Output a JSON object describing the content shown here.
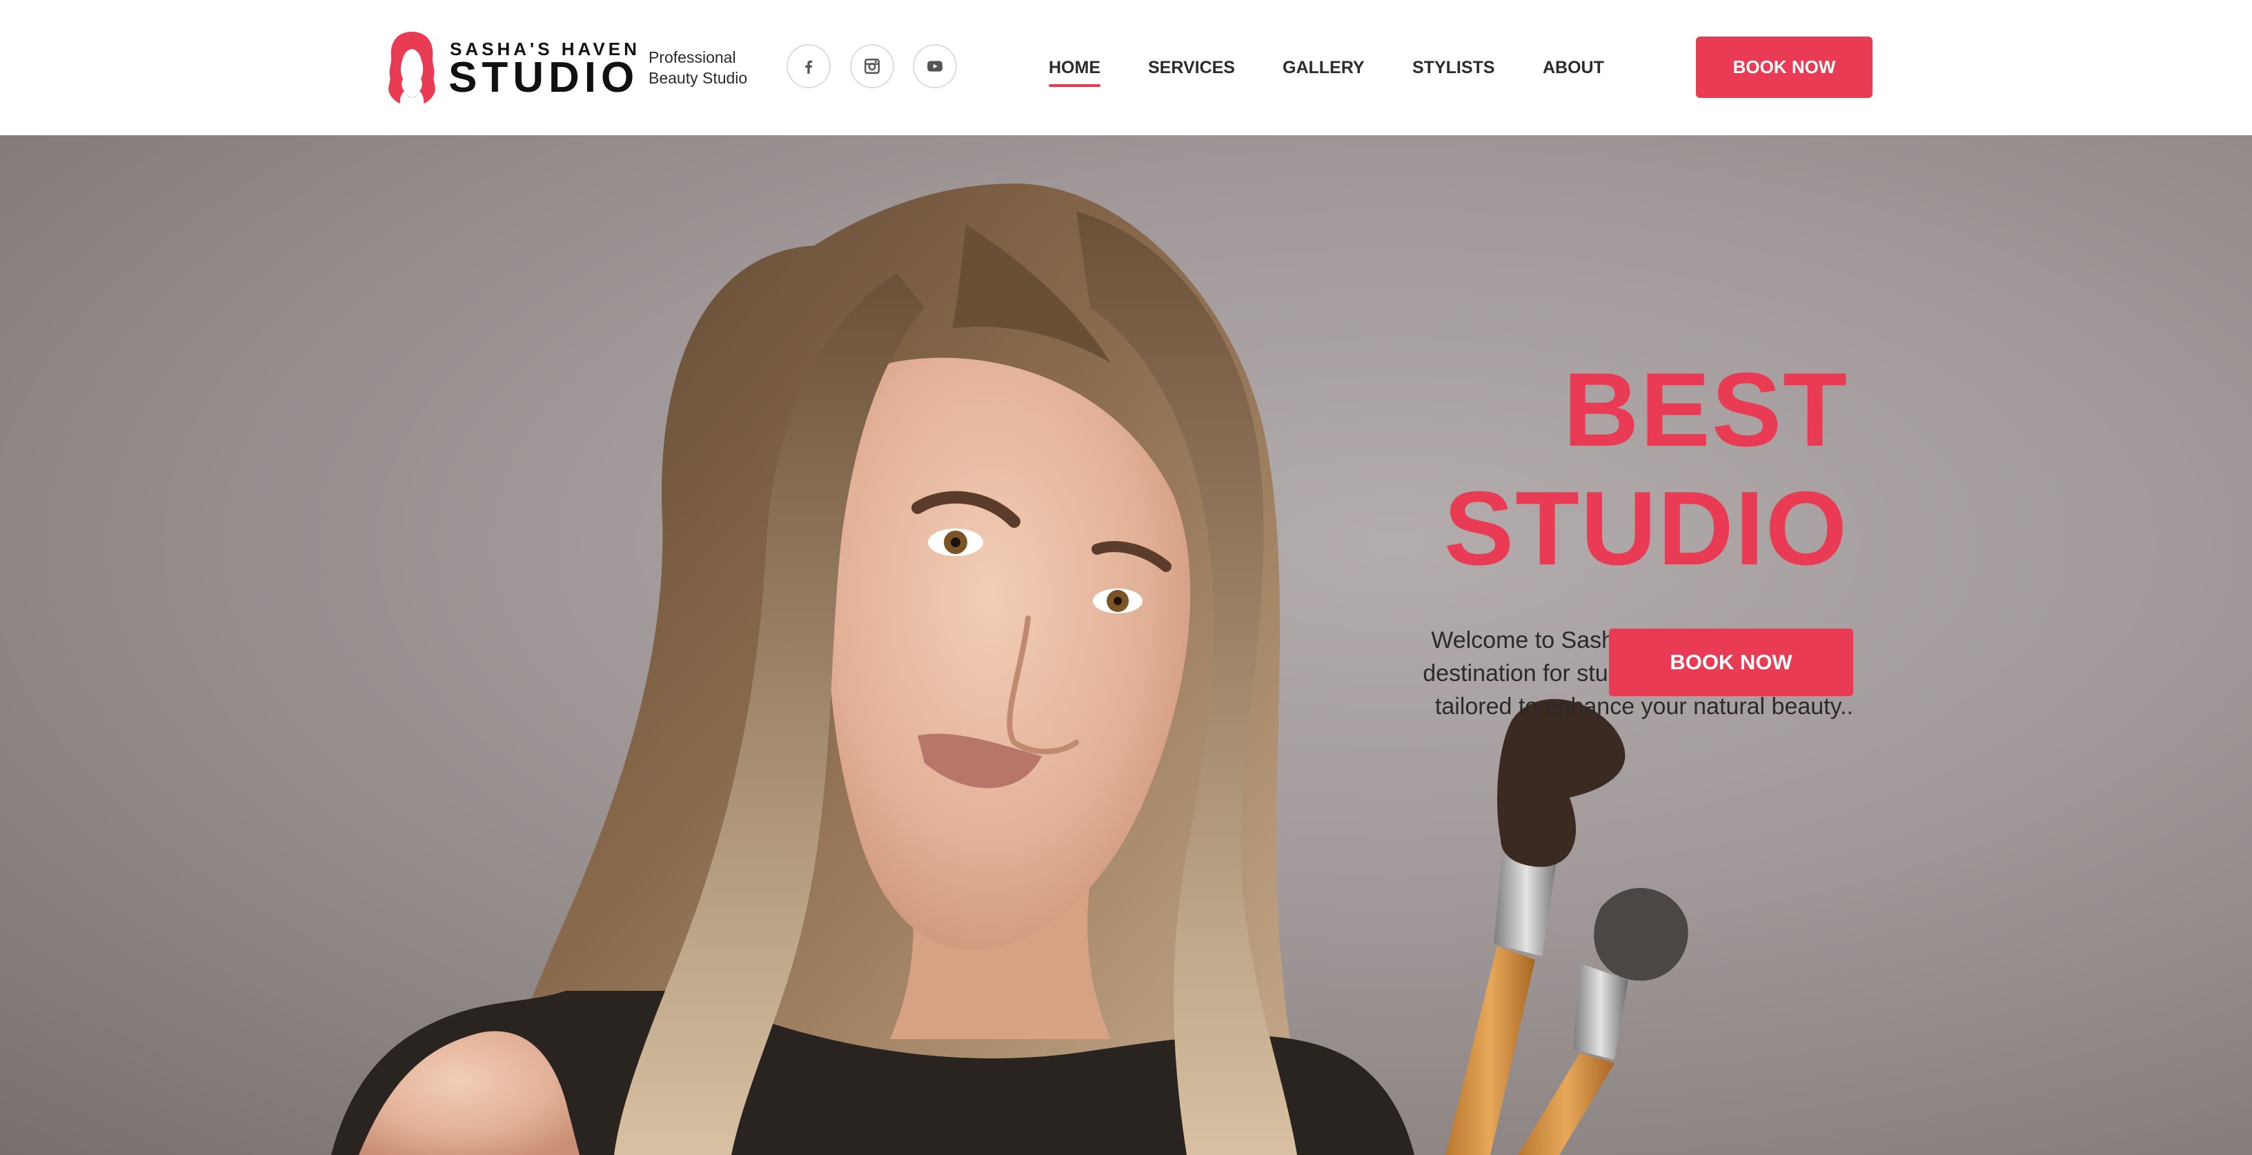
{
  "brand": {
    "name_top": "SASHA'S HAVEN",
    "name_main": "STUDIO",
    "tagline_line1": "Professional",
    "tagline_line2": "Beauty Studio",
    "accent_color": "#ea3b54"
  },
  "social": [
    {
      "icon": "facebook-icon"
    },
    {
      "icon": "instagram-icon"
    },
    {
      "icon": "youtube-icon"
    }
  ],
  "nav": {
    "items": [
      {
        "label": "HOME",
        "active": true
      },
      {
        "label": "SERVICES",
        "active": false
      },
      {
        "label": "GALLERY",
        "active": false
      },
      {
        "label": "STYLISTS",
        "active": false
      },
      {
        "label": "ABOUT",
        "active": false
      }
    ],
    "cta_label": "BOOK NOW"
  },
  "hero": {
    "title_line1": "BEST",
    "title_line2": "STUDIO",
    "desc_line1": "Welcome to Sasha Beauty Studio – Your",
    "desc_line2": "destination for stunning hair and makeup,",
    "desc_line3": "tailored to enhance your natural beauty..",
    "cta_label": "BOOK NOW"
  }
}
